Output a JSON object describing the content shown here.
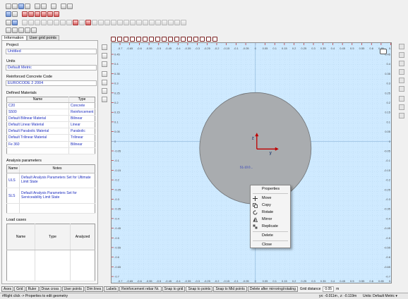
{
  "left_panel": {
    "tabs": [
      "Information",
      "User grid points"
    ],
    "project_label": "Project",
    "project_value": "Untitled",
    "units_label": "Units",
    "units_value": "Default Metric",
    "code_label": "Reinforced Concrete Code",
    "code_value": "EUROCODE 2 2004",
    "materials_label": "Defined Materials",
    "materials_headers": [
      "Name",
      "Type"
    ],
    "materials": [
      [
        "C20",
        "Concrete"
      ],
      [
        "S500",
        "Reinforcement"
      ],
      [
        "Default Bilinear Material",
        "Bilinear"
      ],
      [
        "Default Linear Material",
        "Linear"
      ],
      [
        "Default Parabolic Material",
        "Parabolic"
      ],
      [
        "Default Trilinear Material",
        "Trilinear"
      ],
      [
        "Fe 360",
        "Bilinear"
      ]
    ],
    "analysis_label": "Analysis parameters",
    "analysis_headers": [
      "Name",
      "Notes"
    ],
    "analysis": [
      [
        "ULS",
        "Default Analysis Parameters Set for Ultimate Limit State"
      ],
      [
        "SLS",
        "Default Analysis Parameters Set for Serviceability Limit State"
      ]
    ],
    "loads_label": "Load cases",
    "loads_headers": [
      "Name",
      "Type",
      "Analyzed"
    ]
  },
  "canvas": {
    "background": "#cfeaff",
    "section_fill": "#a9acaf",
    "axis_color": "#c00000",
    "axis_x_label": "y",
    "axis_y_label": "z",
    "point_label": "S1-10.0...",
    "ruler_top": [
      "-0.7",
      "-0.65",
      "-0.6",
      "-0.55",
      "-0.5",
      "-0.45",
      "-0.4",
      "-0.35",
      "-0.3",
      "-0.25",
      "-0.2",
      "-0.15",
      "-0.1",
      "-0.05",
      "0",
      "0.05",
      "0.1",
      "0.15",
      "0.2",
      "0.25",
      "0.3",
      "0.35",
      "0.4",
      "0.45",
      "0.5",
      "0.55",
      "0.6",
      "0.65",
      "0.7"
    ],
    "ruler_side": [
      "0.45",
      "0.4",
      "0.35",
      "0.3",
      "0.25",
      "0.2",
      "0.15",
      "0.1",
      "0.05",
      "0",
      "-0.05",
      "-0.1",
      "-0.15",
      "-0.2",
      "-0.25",
      "-0.3",
      "-0.35",
      "-0.4",
      "-0.45",
      "-0.5",
      "-0.55",
      "-0.6",
      "-0.65",
      "-0.7"
    ]
  },
  "context_menu": {
    "items": [
      "Properties",
      "Move",
      "Copy",
      "Rotate",
      "Mirror",
      "Replicate",
      "Delete",
      "Close"
    ]
  },
  "bottom_bar": {
    "buttons": [
      "Axes",
      "Grid",
      "Ruler",
      "Draw cross",
      "User points",
      "Dim lines",
      "Labels",
      "Reinforcement rebar Nr.",
      "Snap to grid",
      "Snap to points",
      "Snap to Mid points",
      "Delete after mirroring/rotating"
    ],
    "grid_distance_label": "Grid distance",
    "grid_distance_value": "0.05",
    "grid_distance_unit": "m"
  },
  "status": {
    "hint": "#Right click -> Properties to edit geometry",
    "coords": "yx: -0.011m , z: -0.119m",
    "units": "Units: Default Metric ▾"
  }
}
